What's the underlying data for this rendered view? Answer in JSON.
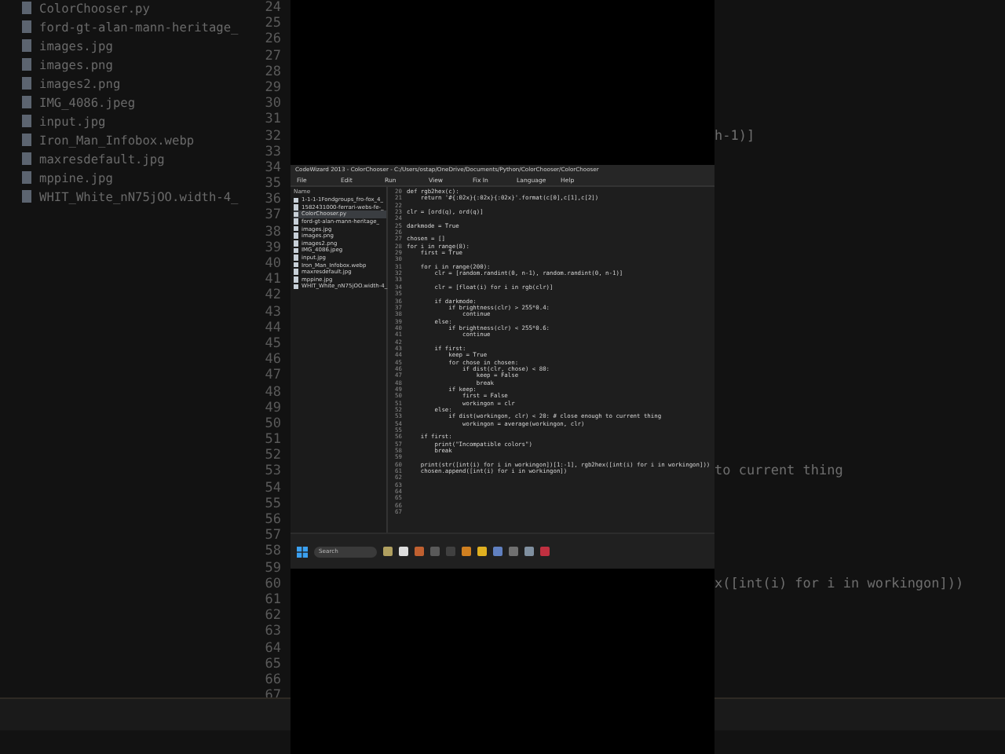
{
  "background": {
    "files": [
      "ColorChooser.py",
      "ford-gt-alan-mann-heritage_",
      "images.jpg",
      "images.png",
      "images2.png",
      "IMG_4086.jpeg",
      "input.jpg",
      "Iron_Man_Infobox.webp",
      "maxresdefault.jpg",
      "mppine.jpg",
      "WHIT_White_nN75jOO.width-4_"
    ],
    "line_numbers": [
      "24",
      "25",
      "26",
      "27",
      "28",
      "29",
      "30",
      "31",
      "32",
      "33",
      "34",
      "35",
      "36",
      "37",
      "38",
      "39",
      "40",
      "41",
      "42",
      "43",
      "44",
      "45",
      "46",
      "47",
      "48",
      "49",
      "50",
      "51",
      "52",
      "53",
      "54",
      "55",
      "56",
      "57",
      "58",
      "59",
      "60",
      "61",
      "62",
      "63",
      "64",
      "65",
      "66",
      "67"
    ],
    "code_fragments": [
      "h-1)]",
      "to current thing",
      "x([int(i) for i in workingon]))"
    ]
  },
  "editor": {
    "title": "CodeWizard 2013 - ColorChooser - C:/Users/ostap/OneDrive/Documents/Python/ColorChooser/ColorChooser",
    "menu": [
      "File",
      "Edit",
      "Run",
      "View",
      "Fix In",
      "Language",
      "Help"
    ],
    "sidebar": {
      "header": "Name",
      "files": [
        {
          "name": "1-1-1-1Fondgroups_fro-fox_4_",
          "selected": false
        },
        {
          "name": "1582431000-ferrari-webs-fe-_",
          "selected": false
        },
        {
          "name": "ColorChooser.py",
          "selected": true
        },
        {
          "name": "ford-gt-alan-mann-heritage_",
          "selected": false
        },
        {
          "name": "images.jpg",
          "selected": false
        },
        {
          "name": "images.png",
          "selected": false
        },
        {
          "name": "images2.png",
          "selected": false
        },
        {
          "name": "IMG_4086.jpeg",
          "selected": false
        },
        {
          "name": "input.jpg",
          "selected": false
        },
        {
          "name": "Iron_Man_Infobox.webp",
          "selected": false
        },
        {
          "name": "maxresdefault.jpg",
          "selected": false
        },
        {
          "name": "mppine.jpg",
          "selected": false
        },
        {
          "name": "WHIT_White_nN75jOO.width-4_",
          "selected": false
        }
      ]
    },
    "lines": [
      {
        "number": "20",
        "text": "def rgb2hex(c):"
      },
      {
        "number": "21",
        "text": "    return '#{:02x}{:02x}{:02x}'.format(c[0],c[1],c[2])"
      },
      {
        "number": "22"
      },
      {
        "number": "23",
        "text": "clr = [ord(q), ord(q)]"
      },
      {
        "number": "24"
      },
      {
        "number": "25",
        "text": "darkmode = True"
      },
      {
        "number": "26"
      },
      {
        "number": "27",
        "text": "chosen = []"
      },
      {
        "number": "28",
        "text": "for i in range(8):"
      },
      {
        "number": "29",
        "text": "    first = True"
      },
      {
        "number": "30"
      },
      {
        "number": "31",
        "text": "    for i in range(200):"
      },
      {
        "number": "32",
        "text": "        clr = [random.randint(0, n-1), random.randint(0, n-1)]"
      },
      {
        "number": "33"
      },
      {
        "number": "34",
        "text": "        clr = [float(i) for i in rgb(clr)]"
      },
      {
        "number": "35"
      },
      {
        "number": "36",
        "text": "        if darkmode:"
      },
      {
        "number": "37",
        "text": "            if brightness(clr) > 255*0.4:"
      },
      {
        "number": "38",
        "text": "                continue"
      },
      {
        "number": "39",
        "text": "        else:"
      },
      {
        "number": "40",
        "text": "            if brightness(clr) < 255*0.6:"
      },
      {
        "number": "41",
        "text": "                continue"
      },
      {
        "number": "42"
      },
      {
        "number": "43",
        "text": "        if first:"
      },
      {
        "number": "44",
        "text": "            keep = True"
      },
      {
        "number": "45",
        "text": "            for chose in chosen:"
      },
      {
        "number": "46",
        "text": "                if dist(clr, chose) < 80:"
      },
      {
        "number": "47",
        "text": "                    keep = False"
      },
      {
        "number": "48",
        "text": "                    break"
      },
      {
        "number": "49",
        "text": "            if keep:"
      },
      {
        "number": "50",
        "text": "                first = False"
      },
      {
        "number": "51",
        "text": "                workingon = clr"
      },
      {
        "number": "52",
        "text": "        else:"
      },
      {
        "number": "53",
        "text": "            if dist(workingon, clr) < 20: # close enough to current thing"
      },
      {
        "number": "54",
        "text": "                workingon = average(workingon, clr)"
      },
      {
        "number": "55"
      },
      {
        "number": "56",
        "text": "    if first:"
      },
      {
        "number": "57",
        "text": "        print(\"Incompatible colors\")"
      },
      {
        "number": "58",
        "text": "        break"
      },
      {
        "number": "59"
      },
      {
        "number": "60",
        "text": "    print(str([int(i) for i in workingon])[1:-1], rgb2hex([int(i) for i in workingon]))"
      },
      {
        "number": "61",
        "text": "    chosen.append([int(i) for i in workingon])"
      },
      {
        "number": "62"
      },
      {
        "number": "63"
      },
      {
        "number": "64"
      },
      {
        "number": "65"
      },
      {
        "number": "66"
      },
      {
        "number": "67"
      }
    ],
    "taskbar": {
      "search_placeholder": "Search"
    }
  }
}
